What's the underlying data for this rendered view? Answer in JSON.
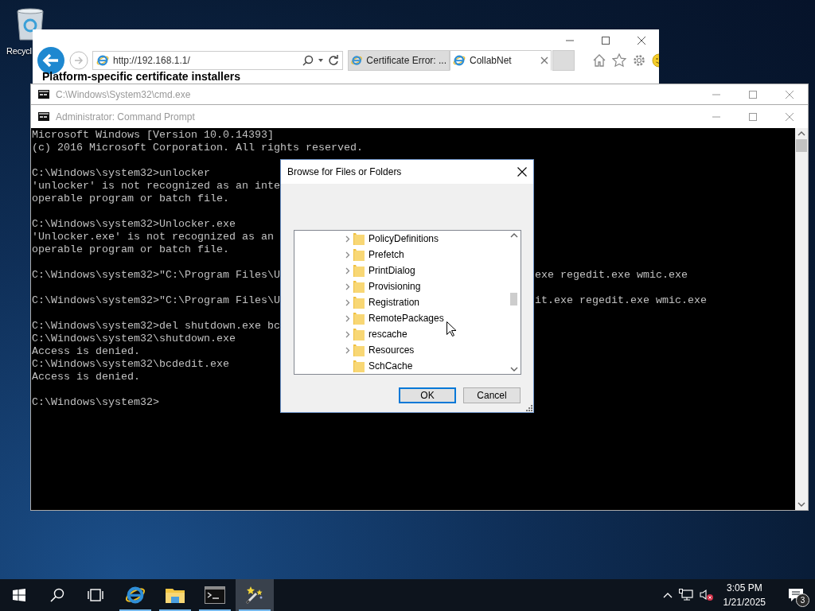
{
  "desktop": {
    "icons": [
      {
        "label": "Recycl"
      }
    ]
  },
  "browser": {
    "address": "http://192.168.1.1/",
    "tabs": [
      {
        "title": "Certificate Error: ...",
        "selected": false
      },
      {
        "title": "CollabNet",
        "selected": true
      }
    ],
    "heading": "Platform-specific certificate installers"
  },
  "cmd_back": {
    "title": "C:\\Windows\\System32\\cmd.exe"
  },
  "cmd": {
    "title": "Administrator: Command Prompt",
    "blocks": [
      [
        {
          "text": "Microsoft Windows [Version 10.0.14393]"
        },
        {
          "text": "(c) 2016 Microsoft Corporation. All rights reserved."
        }
      ],
      [
        {
          "text": "C:\\Windows\\system32>unlocker"
        },
        {
          "text": "'unlocker' is not recognized as an inte"
        },
        {
          "text": "operable program or batch file."
        }
      ],
      [
        {
          "text": "C:\\Windows\\system32>Unlocker.exe"
        },
        {
          "text": "'Unlocker.exe' is not recognized as an"
        },
        {
          "text": "operable program or batch file."
        }
      ],
      [
        {
          "text": "C:\\Windows\\system32>\"C:\\Program Files\\U",
          "tail": "exe regedit.exe wmic.exe"
        }
      ],
      [
        {
          "text": "C:\\Windows\\system32>\"C:\\Program Files\\U",
          "tail": "it.exe regedit.exe wmic.exe"
        }
      ],
      [
        {
          "text": "C:\\Windows\\system32>del shutdown.exe bc"
        },
        {
          "text": "C:\\Windows\\system32\\shutdown.exe"
        },
        {
          "text": "Access is denied."
        },
        {
          "text": "C:\\Windows\\system32\\bcdedit.exe"
        },
        {
          "text": "Access is denied."
        }
      ],
      [
        {
          "text": "C:\\Windows\\system32>"
        }
      ]
    ]
  },
  "dialog": {
    "title": "Browse for Files or Folders",
    "folders": [
      {
        "name": "PolicyDefinitions",
        "expandable": true
      },
      {
        "name": "Prefetch",
        "expandable": true
      },
      {
        "name": "PrintDialog",
        "expandable": true
      },
      {
        "name": "Provisioning",
        "expandable": true
      },
      {
        "name": "Registration",
        "expandable": true
      },
      {
        "name": "RemotePackages",
        "expandable": true
      },
      {
        "name": "rescache",
        "expandable": true
      },
      {
        "name": "Resources",
        "expandable": true
      },
      {
        "name": "SchCache",
        "expandable": false
      }
    ],
    "buttons": [
      {
        "label": "OK",
        "default": true
      },
      {
        "label": "Cancel",
        "default": false
      }
    ]
  },
  "taskbar": {
    "apps": [
      {
        "kind": "browser",
        "running": true,
        "selected": false
      },
      {
        "kind": "explorer",
        "running": true,
        "selected": false
      },
      {
        "kind": "terminal",
        "running": true,
        "selected": false
      },
      {
        "kind": "wand",
        "running": true,
        "selected": true
      }
    ],
    "time": "3:05 PM",
    "date": "1/21/2025",
    "notifications": "3"
  }
}
